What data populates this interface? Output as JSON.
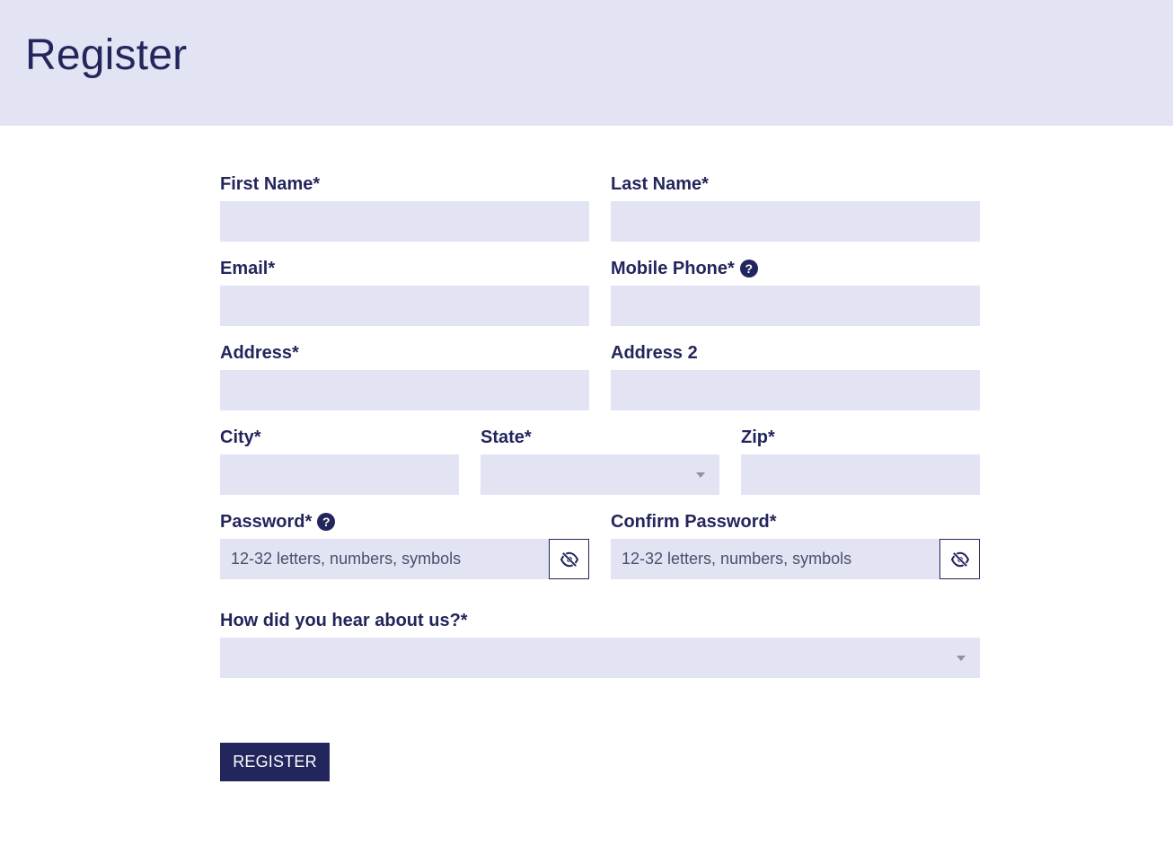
{
  "page": {
    "title": "Register"
  },
  "form": {
    "first_name_label": "First Name*",
    "last_name_label": "Last Name*",
    "email_label": "Email*",
    "mobile_phone_label": "Mobile Phone*",
    "address_label": "Address*",
    "address2_label": "Address 2",
    "city_label": "City*",
    "state_label": "State*",
    "zip_label": "Zip*",
    "password_label": "Password*",
    "confirm_password_label": "Confirm Password*",
    "password_placeholder": "12-32 letters, numbers, symbols",
    "confirm_password_placeholder": "12-32 letters, numbers, symbols",
    "hear_about_label": "How did you hear about us?*",
    "state_value": "",
    "hear_about_value": "",
    "help_glyph": "?",
    "submit_label": "REGISTER"
  },
  "icons": {
    "help": "help-circle-icon",
    "show_password": "eye-slash-icon",
    "dropdown": "caret-down-icon"
  },
  "colors": {
    "primary": "#23265c",
    "field_background": "#e2e3f3",
    "header_background": "#e2e3f3"
  }
}
